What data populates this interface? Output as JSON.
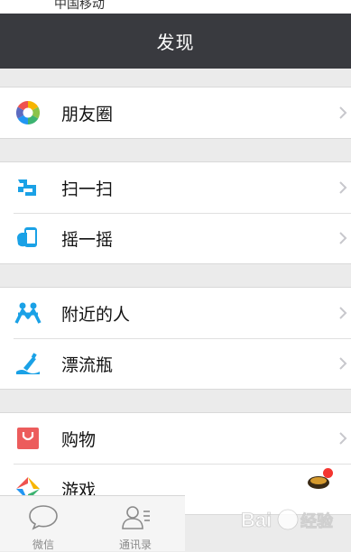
{
  "status_bar": {
    "partial_text": "中国移动",
    "partial_right": ""
  },
  "nav": {
    "title": "发现"
  },
  "groups": [
    {
      "items": [
        {
          "label": "朋友圈",
          "icon": "moments-icon"
        }
      ]
    },
    {
      "items": [
        {
          "label": "扫一扫",
          "icon": "scan-icon"
        },
        {
          "label": "摇一摇",
          "icon": "shake-icon"
        }
      ]
    },
    {
      "items": [
        {
          "label": "附近的人",
          "icon": "people-nearby-icon"
        },
        {
          "label": "漂流瓶",
          "icon": "drift-bottle-icon"
        }
      ]
    },
    {
      "items": [
        {
          "label": "购物",
          "icon": "shopping-icon"
        },
        {
          "label": "游戏",
          "icon": "games-icon"
        }
      ]
    }
  ],
  "tabs": [
    {
      "label": "微信",
      "icon": "chat-bubble-icon"
    },
    {
      "label": "通讯录",
      "icon": "contacts-icon"
    }
  ],
  "watermark": {
    "text": "Baidu经验"
  },
  "colors": {
    "nav_bg": "#393a3f",
    "accent_blue": "#1aa1e6",
    "shopping_red": "#ec5c5c",
    "badge_red": "#f43530"
  }
}
